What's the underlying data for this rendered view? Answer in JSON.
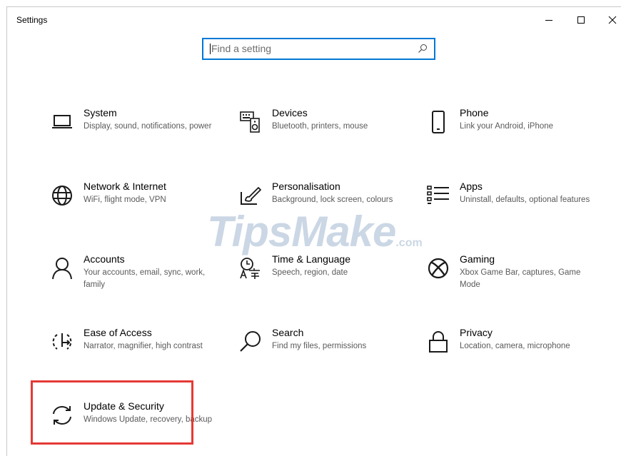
{
  "window": {
    "title": "Settings",
    "controls": {
      "minimize": "minimize",
      "maximize": "maximize",
      "close": "close"
    }
  },
  "search": {
    "placeholder": "Find a setting",
    "icon": "search-icon"
  },
  "categories": [
    {
      "name": "System",
      "desc": "Display, sound, notifications, power",
      "icon": "laptop-icon"
    },
    {
      "name": "Devices",
      "desc": "Bluetooth, printers, mouse",
      "icon": "keyboard-speaker-icon"
    },
    {
      "name": "Phone",
      "desc": "Link your Android, iPhone",
      "icon": "phone-icon"
    },
    {
      "name": "Network & Internet",
      "desc": "WiFi, flight mode, VPN",
      "icon": "globe-icon"
    },
    {
      "name": "Personalisation",
      "desc": "Background, lock screen, colours",
      "icon": "paint-brush-icon"
    },
    {
      "name": "Apps",
      "desc": "Uninstall, defaults, optional features",
      "icon": "apps-list-icon"
    },
    {
      "name": "Accounts",
      "desc": "Your accounts, email, sync, work, family",
      "icon": "person-icon"
    },
    {
      "name": "Time & Language",
      "desc": "Speech, region, date",
      "icon": "time-language-icon"
    },
    {
      "name": "Gaming",
      "desc": "Xbox Game Bar, captures, Game Mode",
      "icon": "xbox-icon"
    },
    {
      "name": "Ease of Access",
      "desc": "Narrator, magnifier, high contrast",
      "icon": "ease-of-access-icon"
    },
    {
      "name": "Search",
      "desc": "Find my files, permissions",
      "icon": "search-icon"
    },
    {
      "name": "Privacy",
      "desc": "Location, camera, microphone",
      "icon": "lock-icon"
    },
    {
      "name": "Update & Security",
      "desc": "Windows Update, recovery, backup",
      "icon": "sync-icon"
    }
  ],
  "watermark": {
    "brand": "TipsMake",
    "suffix": ".com"
  },
  "colors": {
    "accent": "#0078d7",
    "highlight": "#e53935",
    "icon": "#1a1a1a"
  }
}
